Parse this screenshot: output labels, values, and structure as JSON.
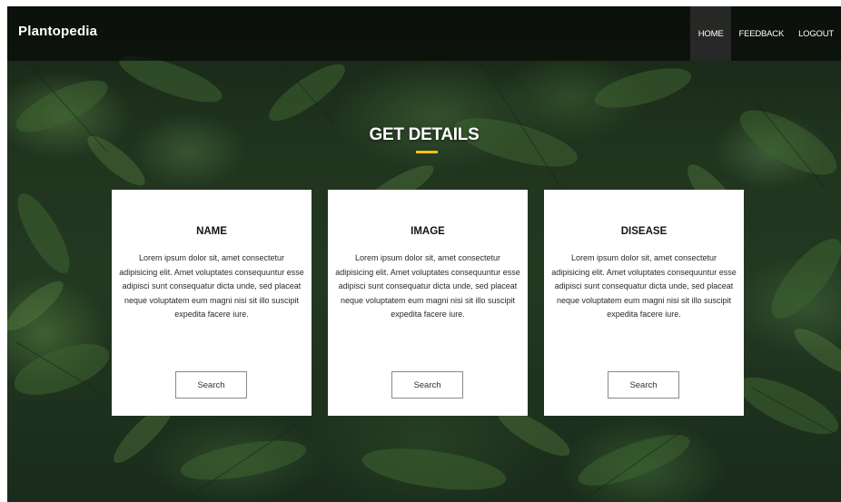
{
  "navbar": {
    "brand": "Plantopedia",
    "links": [
      {
        "label": "HOME",
        "active": true
      },
      {
        "label": "FEEDBACK",
        "active": false
      },
      {
        "label": "LOGOUT",
        "active": false
      }
    ]
  },
  "section": {
    "title": "GET DETAILS",
    "accent_color": "#f2c20f"
  },
  "cards": [
    {
      "heading": "NAME",
      "text": "Lorem ipsum dolor sit, amet consectetur adipisicing elit. Amet voluptates consequuntur esse adipisci sunt consequatur dicta unde, sed placeat neque voluptatem eum magni nisi sit illo suscipit expedita facere iure.",
      "button": "Search"
    },
    {
      "heading": "IMAGE",
      "text": "Lorem ipsum dolor sit, amet consectetur adipisicing elit. Amet voluptates consequuntur esse adipisci sunt consequatur dicta unde, sed placeat neque voluptatem eum magni nisi sit illo suscipit expedita facere iure.",
      "button": "Search"
    },
    {
      "heading": "DISEASE",
      "text": "Lorem ipsum dolor sit, amet consectetur adipisicing elit. Amet voluptates consequuntur esse adipisci sunt consequatur dicta unde, sed placeat neque voluptatem eum magni nisi sit illo suscipit expedita facere iure.",
      "button": "Search"
    }
  ],
  "background": {
    "subject": "tropical-foliage-photo",
    "colors": [
      "#1b2a1a",
      "#2b4529",
      "#6fa04f"
    ]
  }
}
